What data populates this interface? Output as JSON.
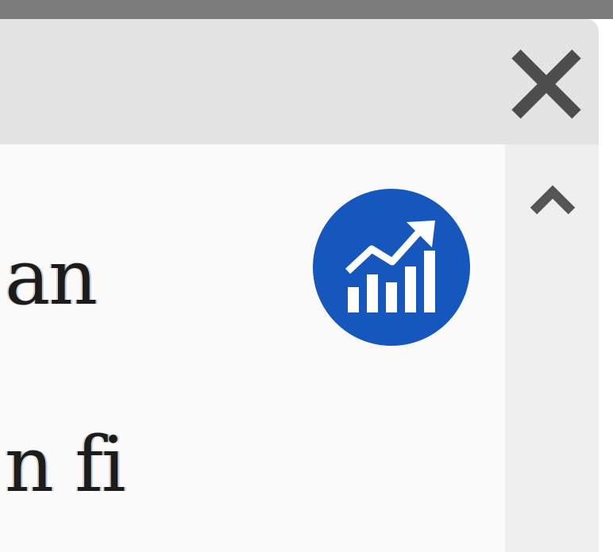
{
  "window": {
    "close_icon": "close-icon",
    "text_lines": [
      "an",
      "n fi"
    ],
    "badge_icon": "chart-growth-icon",
    "badge_color": "#1657bd",
    "scroll_up_icon": "chevron-up-icon"
  }
}
